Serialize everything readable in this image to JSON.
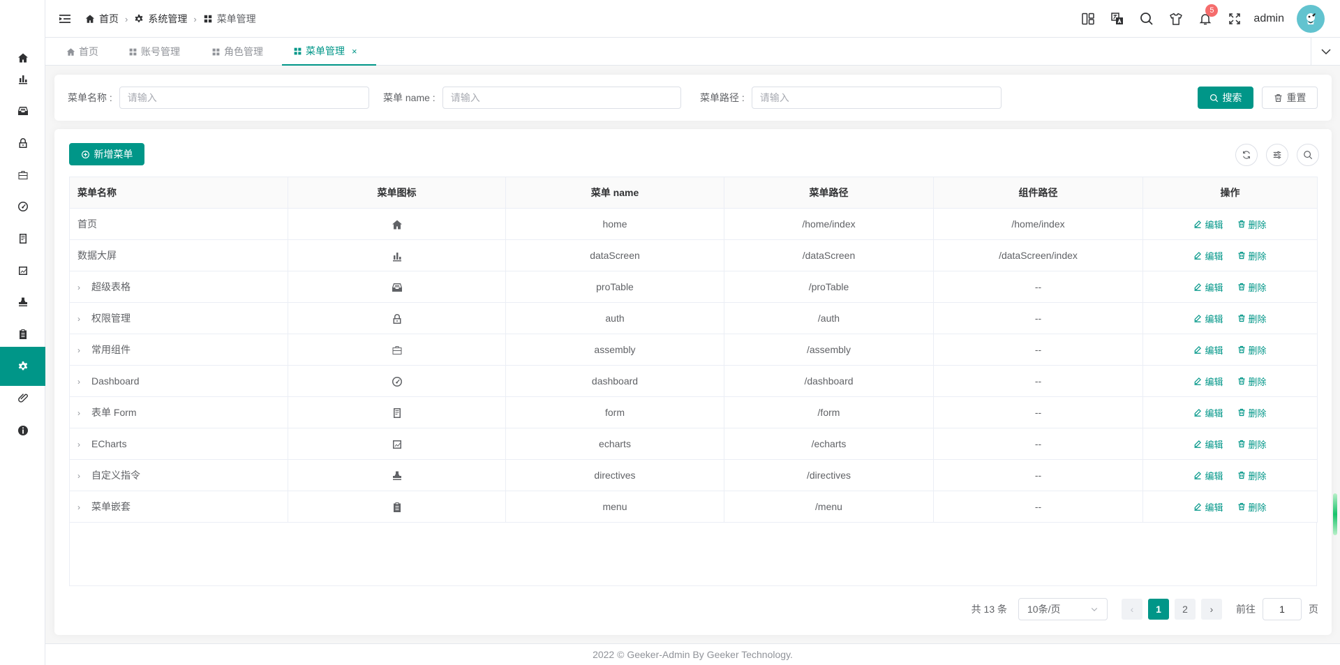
{
  "breadcrumb": [
    "首页",
    "系统管理",
    "菜单管理"
  ],
  "header": {
    "username": "admin",
    "notification_count": "5"
  },
  "tabs": [
    {
      "label": "首页"
    },
    {
      "label": "账号管理"
    },
    {
      "label": "角色管理"
    },
    {
      "label": "菜单管理",
      "active": true
    }
  ],
  "search": {
    "name_label": "菜单名称 :",
    "name_placeholder": "请输入",
    "code_label": "菜单 name :",
    "code_placeholder": "请输入",
    "path_label": "菜单路径 :",
    "path_placeholder": "请输入",
    "search_button": "搜索",
    "reset_button": "重置"
  },
  "toolbar": {
    "add_button": "新增菜单"
  },
  "table": {
    "columns": [
      "菜单名称",
      "菜单图标",
      "菜单 name",
      "菜单路径",
      "组件路径",
      "操作"
    ],
    "edit_label": "编辑",
    "delete_label": "删除",
    "rows": [
      {
        "name": "首页",
        "icon": "home-icon",
        "code": "home",
        "path": "/home/index",
        "component": "/home/index",
        "expandable": false
      },
      {
        "name": "数据大屏",
        "icon": "bar-chart-icon",
        "code": "dataScreen",
        "path": "/dataScreen",
        "component": "/dataScreen/index",
        "expandable": false
      },
      {
        "name": "超级表格",
        "icon": "tray-icon",
        "code": "proTable",
        "path": "/proTable",
        "component": "--",
        "expandable": true
      },
      {
        "name": "权限管理",
        "icon": "lock-icon",
        "code": "auth",
        "path": "/auth",
        "component": "--",
        "expandable": true
      },
      {
        "name": "常用组件",
        "icon": "briefcase-icon",
        "code": "assembly",
        "path": "/assembly",
        "component": "--",
        "expandable": true
      },
      {
        "name": "Dashboard",
        "icon": "odometer-icon",
        "code": "dashboard",
        "path": "/dashboard",
        "component": "--",
        "expandable": true
      },
      {
        "name": "表单 Form",
        "icon": "document-icon",
        "code": "form",
        "path": "/form",
        "component": "--",
        "expandable": true
      },
      {
        "name": "ECharts",
        "icon": "trend-chart-icon",
        "code": "echarts",
        "path": "/echarts",
        "component": "--",
        "expandable": true
      },
      {
        "name": "自定义指令",
        "icon": "stamp-icon",
        "code": "directives",
        "path": "/directives",
        "component": "--",
        "expandable": true
      },
      {
        "name": "菜单嵌套",
        "icon": "clipboard-icon",
        "code": "menu",
        "path": "/menu",
        "component": "--",
        "expandable": true
      }
    ]
  },
  "pagination": {
    "total": "共 13 条",
    "page_size": "10条/页",
    "pages": [
      "1",
      "2"
    ],
    "current": "1",
    "goto_label": "前往",
    "goto_value": "1",
    "page_suffix": "页"
  },
  "footer": "2022 © Geeker-Admin By Geeker Technology.",
  "colors": {
    "primary": "#009688",
    "badge": "#f56c6c"
  }
}
